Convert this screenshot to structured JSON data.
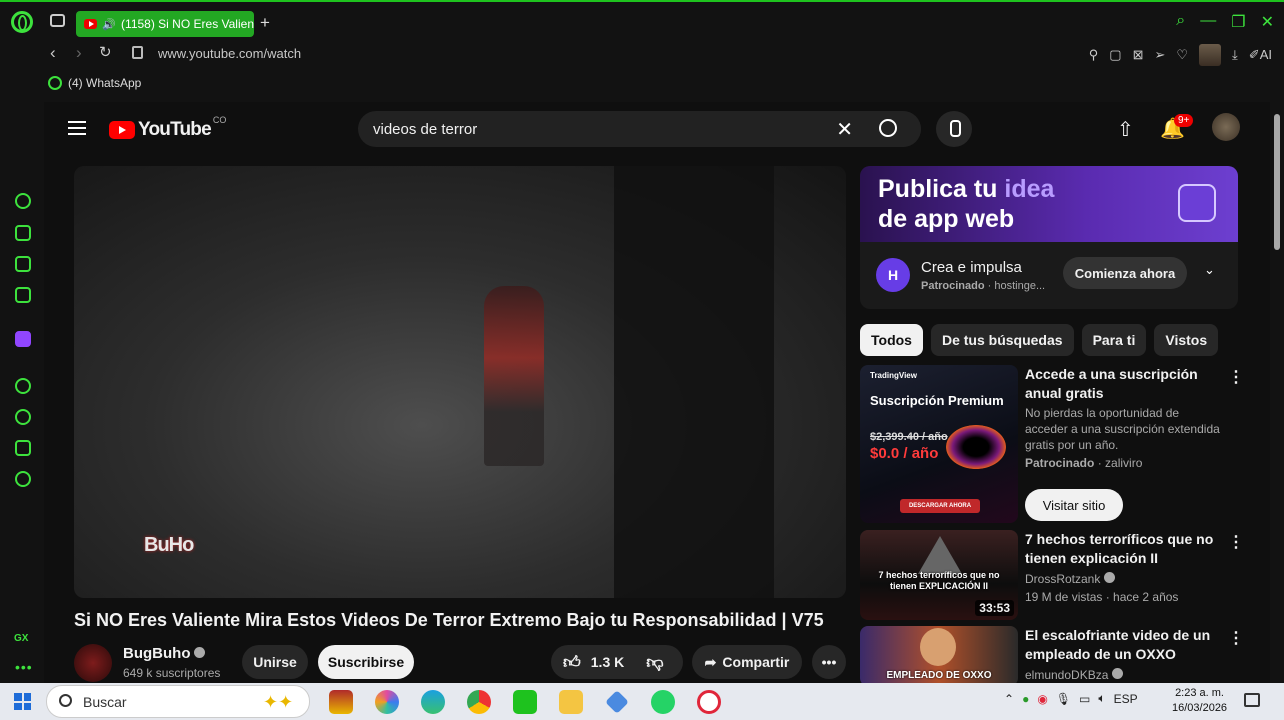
{
  "browser": {
    "tab_title": "(1158) Si NO Eres Valien",
    "tab_add": "+",
    "url": "www.youtube.com/watch",
    "bookmark": "(4) WhatsApp",
    "ai_label": "AI"
  },
  "youtube": {
    "logo_text": "YouTube",
    "country": "CO",
    "search_value": "videos de terror",
    "notification_count": "9+"
  },
  "video": {
    "watermark": "BuHo",
    "title": "Si NO Eres Valiente Mira Estos Videos De Terror Extremo Bajo tu Responsabilidad | V75",
    "channel_name": "BugBuho",
    "channel_subs": "649 k suscriptores",
    "join_label": "Unirse",
    "subscribe_label": "Suscribirse",
    "likes": "1.3 K",
    "share_label": "Compartir",
    "more": "•••"
  },
  "ad": {
    "headline_1": "Publica tu ",
    "headline_accent": "idea",
    "headline_2": "de app web",
    "logo_letter": "H",
    "cta_title": "Crea e impulsa",
    "sponsor_label": "Patrocinado",
    "sponsor_domain": " · hostinge...",
    "cta_button": "Comienza ahora",
    "chevron": "⌄"
  },
  "chips": [
    "Todos",
    "De tus búsquedas",
    "Para ti",
    "Vistos"
  ],
  "recommendations": [
    {
      "title": "Accede a una suscripción anual gratis",
      "desc": "No pierdas la oportunidad de acceder a una suscripción extendida gratis por un año.",
      "sponsor": "Patrocinado",
      "channel": " · zaliviro",
      "button": "Visitar sitio",
      "thumb_brand": "TradingView",
      "thumb_title": "Suscripción Premium",
      "thumb_old_price": "$2,399.40 / año",
      "thumb_new_price": "$0.0 / año",
      "thumb_cta": "DESCARGAR AHORA"
    },
    {
      "title": "7 hechos terroríficos que no tienen explicación II",
      "channel": "DrossRotzank",
      "meta": "19 M de vistas · hace 2 años",
      "duration": "33:53",
      "thumb_text": "7 hechos terroríficos que no tienen EXPLICACIÓN II"
    },
    {
      "title": "El escalofriante video de un empleado de un OXXO",
      "channel": "elmundoDKBza",
      "thumb_text": "EMPLEADO DE OXXO"
    }
  ],
  "taskbar": {
    "search_placeholder": "Buscar",
    "language": "ESP",
    "time": "2:23 a. m.",
    "date": "16/03/2026"
  },
  "colors": {
    "opera_green": "#3de23d",
    "youtube_red": "#ff0000",
    "tab_active": "#23a823",
    "ad_purple": "#5a2bb0"
  }
}
